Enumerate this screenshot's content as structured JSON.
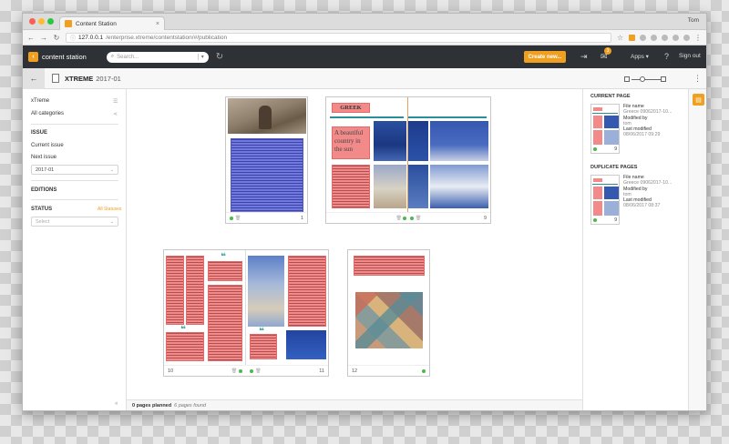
{
  "browser": {
    "tab_title": "Content Station",
    "profile_name": "Tom",
    "url_host": "127.0.0.1",
    "url_path": "/enterprise.xtreme/contentstation/#/publication"
  },
  "header": {
    "brand": "content station",
    "search_placeholder": "Search...",
    "create_label": "Create new...",
    "notification_count": "3",
    "apps_label": "Apps",
    "signout_label": "Sign out",
    "accent_color": "#f0a020"
  },
  "subheader": {
    "publication": "XTREME",
    "issue": "2017-01"
  },
  "filters": {
    "brand": "xTreme",
    "category": "All categories",
    "issue_title": "ISSUE",
    "current_issue": "Current issue",
    "next_issue": "Next issue",
    "issue_value": "2017-01",
    "editions_title": "EDITIONS",
    "status_title": "STATUS",
    "status_count": "All Statuses",
    "status_placeholder": "Select"
  },
  "pages": {
    "spread1": {
      "left_num": "1",
      "right_num": "9"
    },
    "spread1_right": {
      "greek_label": "GREEK",
      "headline": "A beautiful country in the sun"
    },
    "spread2": {
      "left_num": "10",
      "right_num": "11",
      "single_num": "12"
    }
  },
  "footer": {
    "planned": "0 pages planned",
    "found": "6 pages found"
  },
  "right_panel": {
    "current_title": "CURRENT PAGE",
    "duplicate_title": "DUPLICATE PAGES",
    "file_name_label": "File name",
    "file_name_value": "Greece 09062017-10...",
    "modified_by_label": "Modified by",
    "modified_by_value": "tom",
    "last_modified_label": "Last modified",
    "current_last_modified": "08/06/2017 09:29",
    "duplicate_last_modified": "08/06/2017 08:37",
    "thumb_num": "9"
  }
}
